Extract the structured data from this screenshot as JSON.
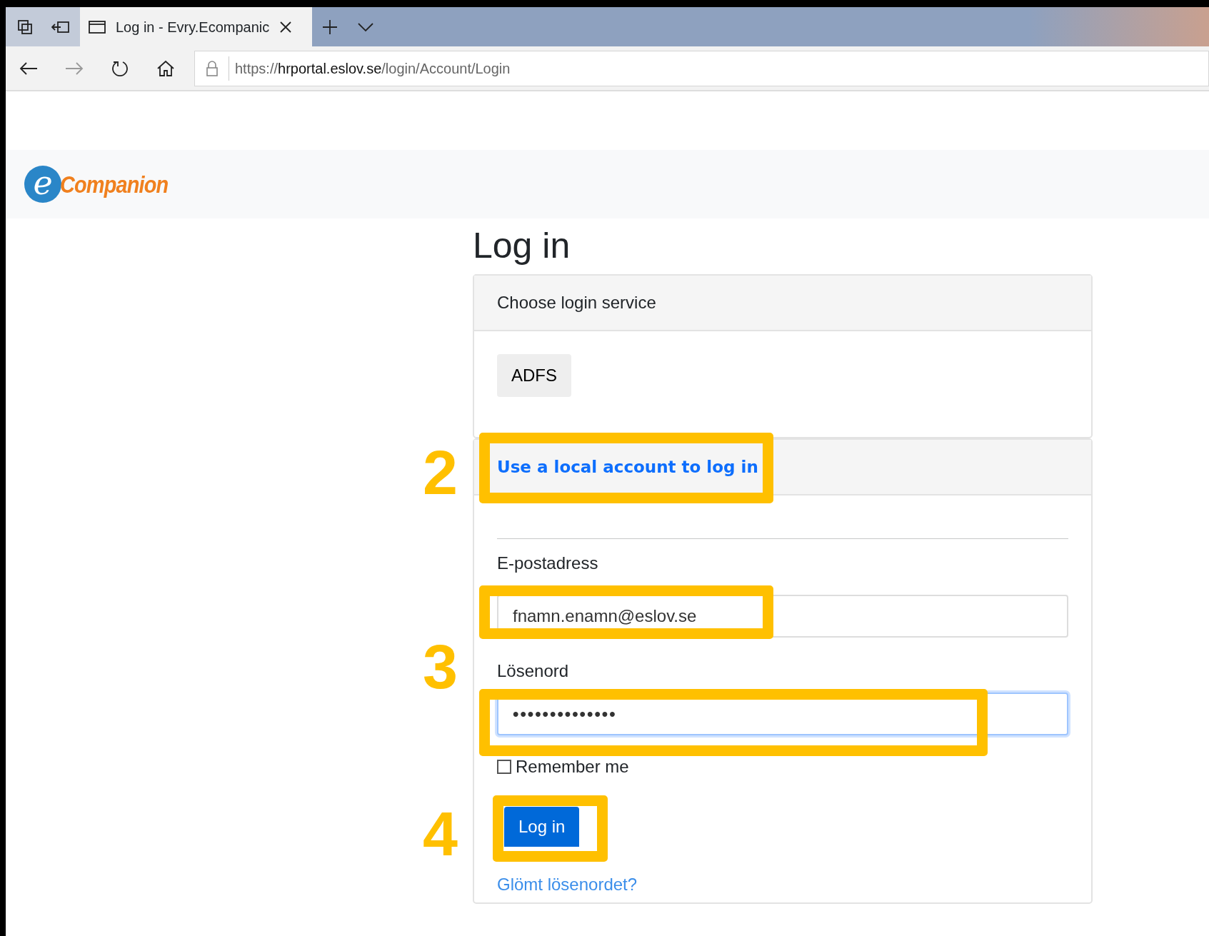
{
  "browser": {
    "tab_title": "Log in - Evry.Ecompanic",
    "url_scheme": "https://",
    "url_host": "hrportal.eslov.se",
    "url_path": "/login/Account/Login"
  },
  "logo": {
    "mark": "e",
    "name": "Companion"
  },
  "heading": "Log in",
  "login_service": {
    "header": "Choose login service",
    "buttons": [
      "ADFS"
    ]
  },
  "local_login": {
    "header": "Use a local account to log in",
    "email_label": "E-postadress",
    "email_value": "fnamn.enamn@eslov.se",
    "password_label": "Lösenord",
    "password_value": "••••••••••••••",
    "remember_me": {
      "label": "Remember me",
      "checked": false
    },
    "submit": "Log in",
    "forgot_link": "Glömt lösenordet?"
  },
  "annotations": [
    {
      "number": "2"
    },
    {
      "number": "3"
    },
    {
      "number": "4"
    }
  ]
}
